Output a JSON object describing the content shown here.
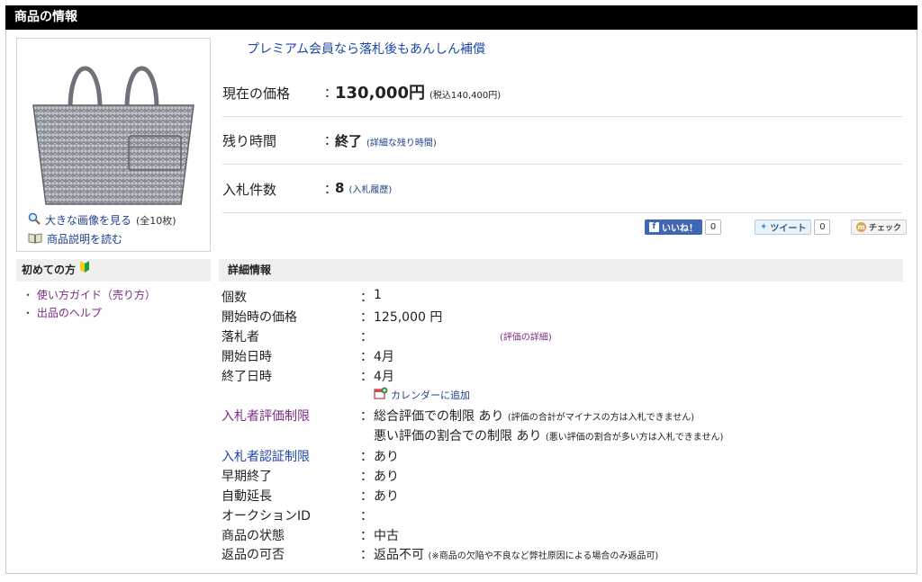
{
  "header": {
    "title": "商品の情報"
  },
  "image_panel": {
    "view_large": "大きな画像を見る",
    "view_large_count": "(全10枚)",
    "read_description": "商品説明を読む"
  },
  "summary": {
    "premium_text": "プレミアム会員なら落札後もあんしん補償",
    "price_label": "現在の価格",
    "price_value": "130,000円",
    "price_tax": "(税込140,400円)",
    "time_label": "残り時間",
    "time_value": "終了",
    "time_link": "(詳細な残り時間)",
    "bids_label": "入札件数",
    "bids_value": "8",
    "bids_link": "(入札履歴)",
    "colon": "："
  },
  "social": {
    "like_label": "いいね！",
    "like_count": "0",
    "tweet_label": "ツイート",
    "tweet_count": "0",
    "check_label": "チェック"
  },
  "sidebar": {
    "heading": "初めての方",
    "links": [
      "・ 使い方ガイド（売り方）",
      "・ 出品のヘルプ"
    ]
  },
  "details": {
    "heading": "詳細情報",
    "colon": "：",
    "rows": [
      {
        "label": "個数",
        "value": "1"
      },
      {
        "label": "開始時の価格",
        "value": "125,000 円"
      },
      {
        "label": "落札者",
        "value": "",
        "link": "(評価の詳細)"
      },
      {
        "label": "開始日時",
        "value": "4月"
      },
      {
        "label": "終了日時",
        "value": "4月"
      },
      {
        "label": "入札者評価制限",
        "value": "総合評価での制限 あり",
        "note": "(評価の合計がマイナスの方は入札できません)"
      },
      {
        "label": "",
        "value": "悪い評価の割合での制限 あり",
        "note": "(悪い評価の割合が多い方は入札できません)"
      },
      {
        "label": "入札者認証制限",
        "value": "あり"
      },
      {
        "label": "早期終了",
        "value": "あり"
      },
      {
        "label": "自動延長",
        "value": "あり"
      },
      {
        "label": "オークションID",
        "value": ""
      },
      {
        "label": "商品の状態",
        "value": "中古"
      },
      {
        "label": "返品の可否",
        "value": "返品不可",
        "note": "(※商品の欠陥や不良など弊社原因による場合のみ返品可)"
      }
    ],
    "calendar_link": "カレンダーに追加"
  },
  "colors": {
    "header_bg": "#000000",
    "link_blue": "#1f47a8",
    "link_purple": "#7b2b84",
    "panel_gray": "#efefef"
  }
}
